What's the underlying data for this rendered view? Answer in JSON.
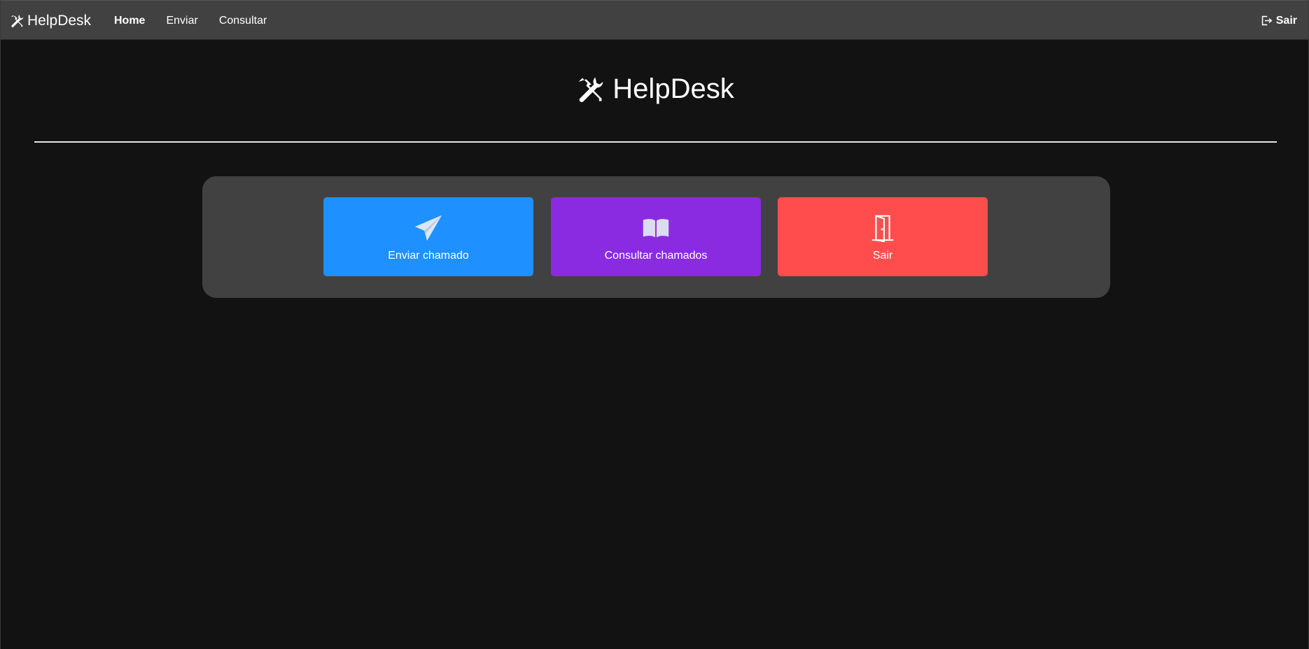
{
  "navbar": {
    "brand_label": "HelpDesk",
    "links": [
      {
        "label": "Home",
        "active": true
      },
      {
        "label": "Enviar",
        "active": false
      },
      {
        "label": "Consultar",
        "active": false
      }
    ],
    "logout_label": "Sair",
    "background": "#414141"
  },
  "hero": {
    "title": "HelpDesk",
    "icon": "tools-icon"
  },
  "actions": [
    {
      "label": "Enviar chamado",
      "icon": "paper-plane-icon",
      "color": "#1e90ff"
    },
    {
      "label": "Consultar chamados",
      "icon": "book-open-icon",
      "color": "#8a2be2"
    },
    {
      "label": "Sair",
      "icon": "door-open-icon",
      "color": "#ff4d4d"
    }
  ],
  "colors": {
    "page_background": "#121212",
    "panel_background": "#414141"
  }
}
